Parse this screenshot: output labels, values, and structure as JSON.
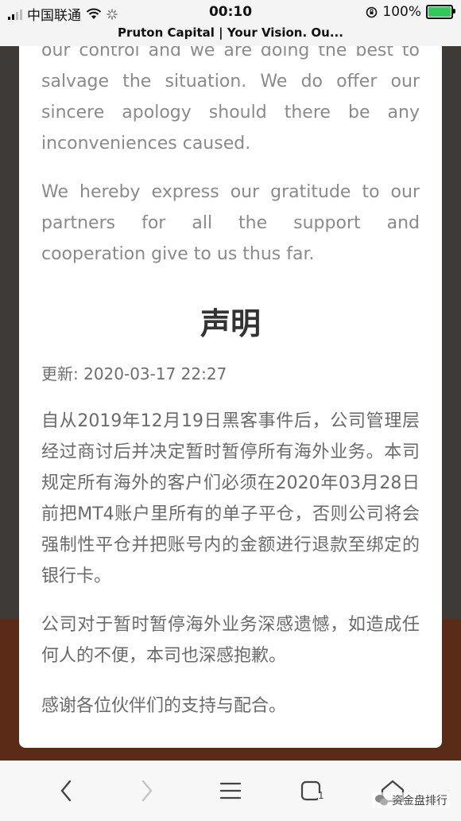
{
  "status_bar": {
    "carrier": "中国联通",
    "time": "00:10",
    "battery_percent": "100%",
    "battery_level": 1.0,
    "battery_color": "#34c759"
  },
  "browser": {
    "page_title": "Pruton Capital | Your Vision. Ou..."
  },
  "content": {
    "english_paragraph_1": "our control and we are doing the best to salvage the situation. We do offer our sincere apology should there be any inconveniences caused.",
    "english_paragraph_2": "We hereby express our gratitude to our partners for all the support and cooperation give to us thus far.",
    "heading": "声明",
    "updated": "更新: 2020-03-17 22:27",
    "chinese_paragraph_1": "自从2019年12月19日黑客事件后，公司管理层经过商讨后并决定暂时暂停所有海外业务。本司规定所有海外的客户们必须在2020年03月28日前把MT4账户里所有的单子平仓，否则公司将会强制性平仓并把账号内的金额进行退款至绑定的银行卡。",
    "chinese_paragraph_2": "公司对于暂时暂停海外业务深感遗憾，如造成任何人的不便，本司也深感抱歉。",
    "chinese_paragraph_3": "感谢各位伙伴们的支持与配合。"
  },
  "bottom_nav": {
    "icons": [
      "back-icon",
      "forward-icon",
      "menu-icon",
      "tabs-icon",
      "home-icon"
    ]
  },
  "watermark": {
    "text": "资金盘排行"
  }
}
